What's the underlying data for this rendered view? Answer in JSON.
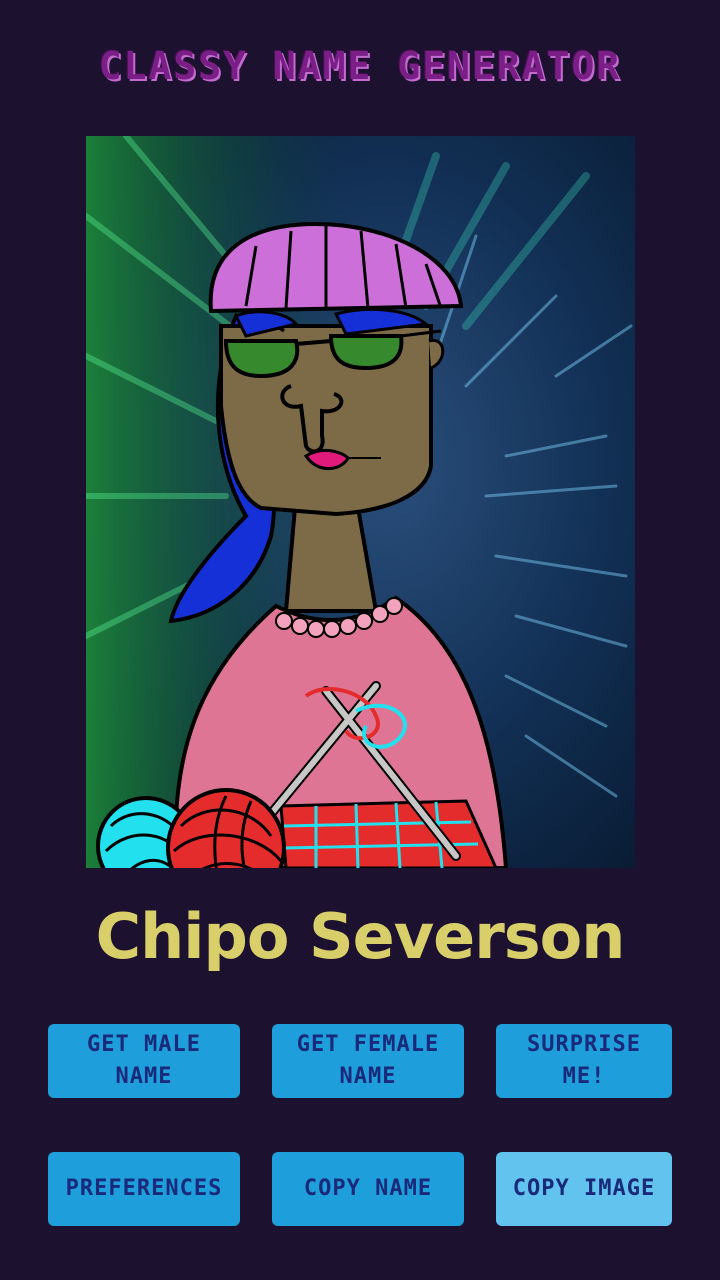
{
  "app": {
    "title": "Classy Name Generator"
  },
  "result": {
    "name": "Chipo Severson"
  },
  "buttons": {
    "get_male_name": "Get Male Name",
    "get_female_name": "Get Female Name",
    "surprise_me": "Surprise Me!",
    "preferences": "Preferences",
    "copy_name": "Copy Name",
    "copy_image": "Copy Image"
  },
  "colors": {
    "background": "#1c1230",
    "title": "#7a1f86",
    "name": "#d9cf6a",
    "button": "#1e9edb",
    "button_light": "#62c3ee",
    "button_text": "#1a2a7a"
  }
}
